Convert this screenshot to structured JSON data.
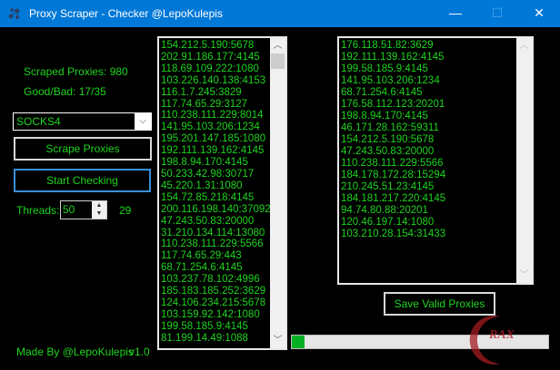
{
  "window": {
    "title": "Proxy Scraper - Checker @LepoKulepis",
    "minimize": "—",
    "maximize": "☐",
    "close": "✕"
  },
  "stats": {
    "scraped": "Scraped Proxies: 980",
    "good_bad": "Good/Bad: 17/35"
  },
  "proxy_type": {
    "selected": "SOCKS4"
  },
  "buttons": {
    "scrape": "Scrape Proxies",
    "check": "Start Checking",
    "save": "Save Valid Proxies"
  },
  "threads": {
    "label": "Threads:",
    "value": "50",
    "count": "29"
  },
  "footer": {
    "credit": "Made By @LepoKulepis",
    "version": "v1.0"
  },
  "progress": {
    "percent": 5
  },
  "watermark": {
    "text": "RAX FORUMS"
  },
  "scraped_list": [
    "154.212.5.190:5678",
    "202.91.186.177:4145",
    "118.69.109.222:1080",
    "103.226.140.138:4153",
    "116.1.7.245:3829",
    "117.74.65.29:3127",
    "110.238.111.229:8014",
    "141.95.103.206:1234",
    "195.201.147.185:1080",
    "192.111.139.162:4145",
    "198.8.94.170:4145",
    "50.233.42.98:30717",
    "45.220.1.31:1080",
    "154.72.85.218:4145",
    "200.116.198.140:37092",
    "47.243.50.83:20000",
    "31.210.134.114:13080",
    "110.238.111.229:5566",
    "117.74.65.29:443",
    "68.71.254.6:4145",
    "103.237.78.102:4996",
    "185.183.185.252:3629",
    "124.106.234.215:5678",
    "103.159.92.142:1080",
    "199.58.185.9:4145",
    "81.199.14.49:1088"
  ],
  "valid_list": [
    "176.118.51.82:3629",
    "192.111.139.162:4145",
    "199.58.185.9:4145",
    "141.95.103.206:1234",
    "68.71.254.6:4145",
    "176.58.112.123:20201",
    "198.8.94.170:4145",
    "46.171.28.162:59311",
    "154.212.5.190:5678",
    "47.243.50.83:20000",
    "110.238.111.229:5566",
    "184.178.172.28:15294",
    "210.245.51.23:4145",
    "184.181.217.220:4145",
    "94.74.80.88:20201",
    "120.46.197.14:1080",
    "103.210.28.154:31433"
  ]
}
